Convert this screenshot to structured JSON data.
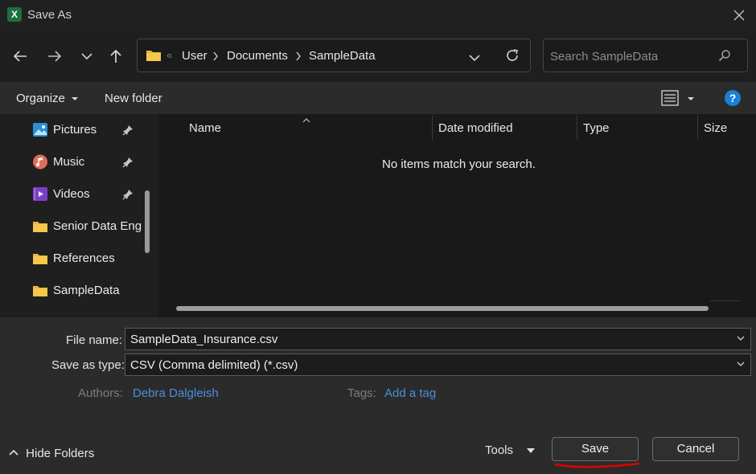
{
  "titlebar": {
    "app_icon_label": "X",
    "title": "Save As"
  },
  "nav": {
    "breadcrumb_sep": "«",
    "breadcrumb": [
      "User",
      "Documents",
      "SampleData"
    ],
    "search_placeholder": "Search SampleData"
  },
  "toolbar": {
    "organize": "Organize",
    "new_folder": "New folder"
  },
  "sidebar": {
    "items": [
      {
        "label": "Pictures",
        "icon": "pictures-icon",
        "pinned": true
      },
      {
        "label": "Music",
        "icon": "music-icon",
        "pinned": true
      },
      {
        "label": "Videos",
        "icon": "videos-icon",
        "pinned": true
      },
      {
        "label": "Senior Data Eng",
        "icon": "folder-icon",
        "pinned": false
      },
      {
        "label": "References",
        "icon": "folder-icon",
        "pinned": false
      },
      {
        "label": "SampleData",
        "icon": "folder-icon",
        "pinned": false
      }
    ]
  },
  "filelist": {
    "columns": [
      "Name",
      "Date modified",
      "Type",
      "Size"
    ],
    "empty_message": "No items match your search."
  },
  "form": {
    "filename_label": "File name:",
    "filename_value": "SampleData_Insurance.csv",
    "savetype_label": "Save as type:",
    "savetype_value": "CSV (Comma delimited) (*.csv)",
    "authors_label": "Authors:",
    "authors_value": "Debra Dalgleish",
    "tags_label": "Tags:",
    "tags_value": "Add a tag"
  },
  "footer": {
    "hide_folders": "Hide Folders",
    "tools": "Tools",
    "save": "Save",
    "cancel": "Cancel"
  },
  "colors": {
    "background": "#1f1f1f",
    "accent_link": "#4a90d9",
    "help_blue": "#1a7fd6",
    "annotation_red": "#e00000",
    "excel_green": "#1d6f42"
  }
}
